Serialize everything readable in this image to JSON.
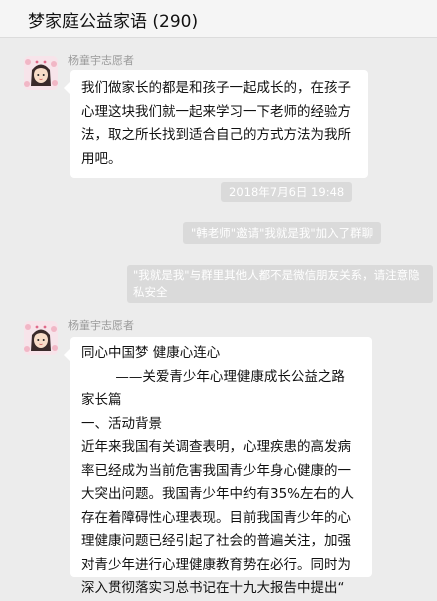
{
  "header": {
    "title": "梦家庭公益家语 (290)"
  },
  "messages": [
    {
      "sender": "杨童宇志愿者",
      "avatar_icon": "girl-avatar-icon",
      "lines": [
        "我们做家长的都是和孩子一起成长的，在孩子",
        "心理这块我们就一起来学习一下老师的经验方",
        "法，取之所长找到适合自己的方式方法为我所",
        "用吧。"
      ]
    },
    {
      "sender": "杨童宇志愿者",
      "avatar_icon": "girl-avatar-icon",
      "lines": [
        "同心中国梦  健康心连心",
        "        ——关爱青少年心理健康成长公益之路",
        "家长篇",
        "一、活动背景",
        "近年来我国有关调查表明，心理疾患的高发病",
        "率已经成为当前危害我国青少年身心健康的一",
        "大突出问题。我国青少年中约有35%左右的人",
        "存在着障碍性心理表现。目前我国青少年的心",
        "理健康问题已经引起了社会的普遍关注，加强",
        "对青少年进行心理健康教育势在必行。同时为",
        "深入贯彻落实习总书记在十九大报告中提出“"
      ]
    }
  ],
  "system": {
    "timestamp": "2018年7月6日 19:48",
    "invite_notice": "\"韩老师\"邀请\"我就是我\"加入了群聊",
    "warning_lines": [
      "\"我就是我\"与群里其他人都不是微信朋友关系，请注意隐",
      "私安全"
    ]
  }
}
